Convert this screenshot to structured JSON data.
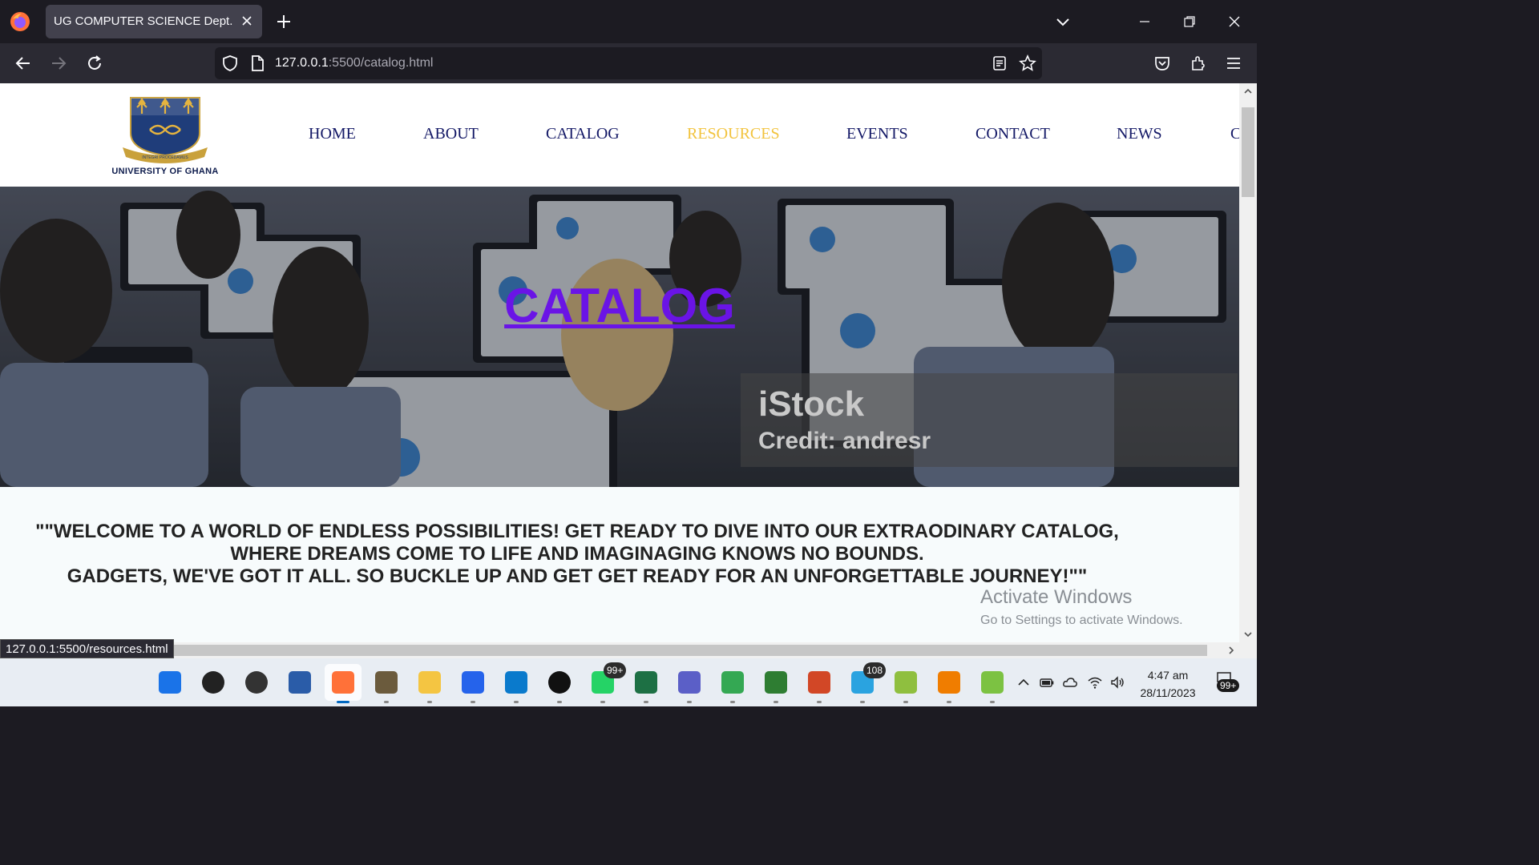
{
  "browser": {
    "tab_title": "UG COMPUTER SCIENCE Dept.",
    "url_host": "127.0.0.1",
    "url_rest": ":5500/catalog.html",
    "status_url": "127.0.0.1:5500/resources.html"
  },
  "site": {
    "logo_text": "UNIVERSITY OF GHANA",
    "nav": [
      "HOME",
      "ABOUT",
      "CATALOG",
      "RESOURCES",
      "EVENTS",
      "CONTACT",
      "NEWS",
      "C"
    ],
    "active_nav": "RESOURCES",
    "hero_title": "CATALOG",
    "watermark_logo": "iStock",
    "watermark_credit": "Credit: andresr",
    "welcome_lines": [
      "\"\"WELCOME TO A WORLD OF ENDLESS POSSIBILITIES! GET READY TO DIVE INTO OUR EXTRAODINARY CATALOG,",
      "WHERE DREAMS COME TO LIFE AND IMAGINAGING KNOWS NO BOUNDS.",
      "GADGETS, WE'VE GOT IT ALL. SO BUCKLE UP AND GET GET READY FOR AN UNFORGETTABLE JOURNEY!\"\""
    ]
  },
  "windows_notice": {
    "title": "Activate Windows",
    "subtitle": "Go to Settings to activate Windows."
  },
  "taskbar": {
    "apps": [
      {
        "name": "windows-start",
        "color": "#1a73e8"
      },
      {
        "name": "search",
        "color": "#222222"
      },
      {
        "name": "task-view",
        "color": "#333333"
      },
      {
        "name": "widgets",
        "color": "#2a5ca8"
      },
      {
        "name": "firefox",
        "color": "#ff7139"
      },
      {
        "name": "photos",
        "color": "#6b5b3d"
      },
      {
        "name": "file-explorer",
        "color": "#f4c542"
      },
      {
        "name": "microsoft-store",
        "color": "#2563eb"
      },
      {
        "name": "vs-code",
        "color": "#0a7acc"
      },
      {
        "name": "tiktok",
        "color": "#111111"
      },
      {
        "name": "whatsapp",
        "color": "#25d366",
        "badge": "99+"
      },
      {
        "name": "excel",
        "color": "#1d7044"
      },
      {
        "name": "teams",
        "color": "#5b5fc7"
      },
      {
        "name": "chrome",
        "color": "#34a853"
      },
      {
        "name": "globe-app",
        "color": "#2e7d32"
      },
      {
        "name": "powerpoint",
        "color": "#d24726"
      },
      {
        "name": "telegram",
        "color": "#2aa3e0",
        "badge": "108"
      },
      {
        "name": "notepad-plus",
        "color": "#8fbf3f"
      },
      {
        "name": "vlc",
        "color": "#f07d00"
      },
      {
        "name": "android-app",
        "color": "#7cc242"
      }
    ],
    "time": "4:47 am",
    "date": "28/11/2023",
    "notifications": "99+"
  }
}
